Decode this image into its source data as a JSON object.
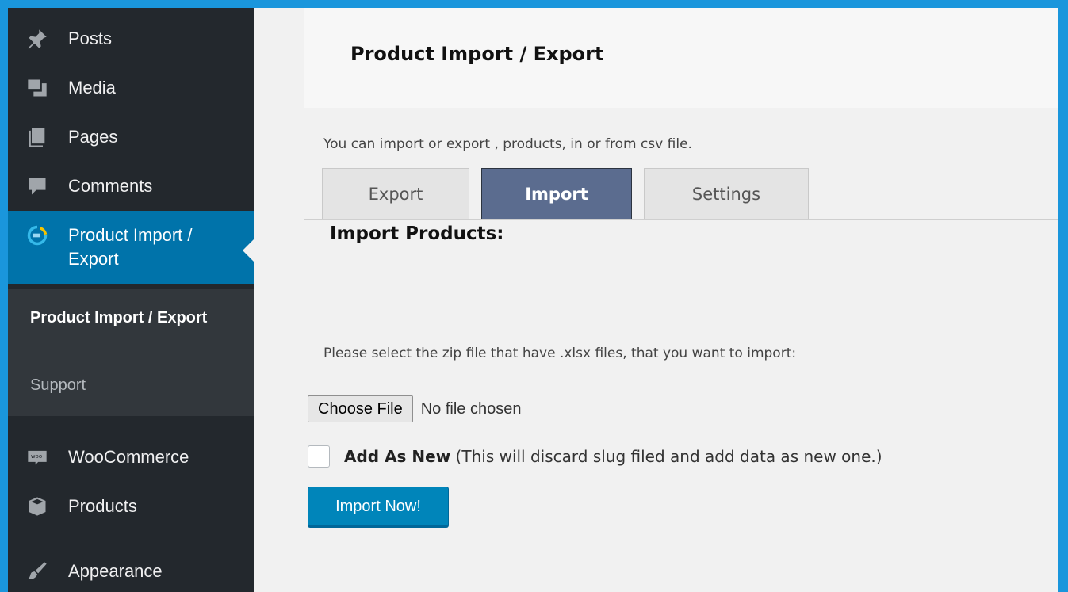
{
  "sidebar": {
    "items": [
      {
        "label": "Posts",
        "icon": "pin-icon"
      },
      {
        "label": "Media",
        "icon": "media-icon"
      },
      {
        "label": "Pages",
        "icon": "pages-icon"
      },
      {
        "label": "Comments",
        "icon": "comment-icon"
      },
      {
        "label": "Product Import / Export",
        "icon": "import-export-icon"
      },
      {
        "label": "WooCommerce",
        "icon": "woo-icon"
      },
      {
        "label": "Products",
        "icon": "box-icon"
      },
      {
        "label": "Appearance",
        "icon": "brush-icon"
      }
    ],
    "submenu": {
      "current": "Product Import / Export",
      "support": "Support"
    },
    "active_color": "#0073aa"
  },
  "main": {
    "title": "Product Import / Export",
    "description": "You can import or export , products, in or from csv file.",
    "tabs": [
      {
        "label": "Export"
      },
      {
        "label": "Import",
        "active": true
      },
      {
        "label": "Settings"
      }
    ],
    "section_heading": "Import Products:",
    "select_prompt": "Please select the zip file that have .xlsx files, that you want to import:",
    "file_input": {
      "button": "Choose File",
      "status": "No file chosen"
    },
    "checkbox": {
      "label_bold": "Add As New",
      "label_rest": " (This will discard slug filed and add data as new one.)",
      "checked": false
    },
    "import_button": "Import Now!"
  }
}
